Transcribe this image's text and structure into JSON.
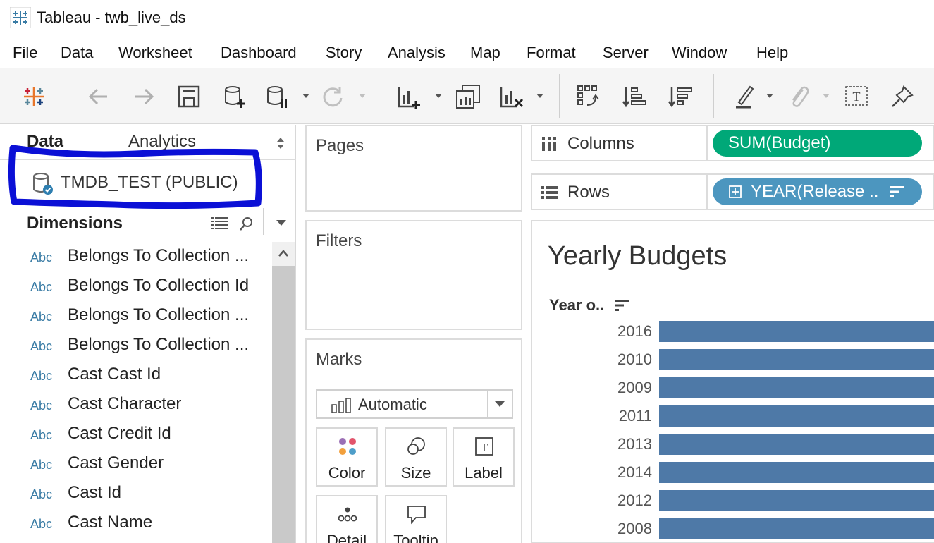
{
  "window": {
    "title": "Tableau - twb_live_ds",
    "app_icon": "tableau-logo-icon"
  },
  "menu": [
    "File",
    "Data",
    "Worksheet",
    "Dashboard",
    "Story",
    "Analysis",
    "Map",
    "Format",
    "Server",
    "Window",
    "Help"
  ],
  "toolbar": {
    "icons": [
      "tableau-logo-icon",
      "back-icon",
      "forward-icon",
      "save-icon",
      "new-data-source-icon",
      "pause-updates-icon",
      "refresh-icon",
      "new-worksheet-icon",
      "duplicate-sheet-icon",
      "clear-sheet-icon",
      "swap-rows-columns-icon",
      "sort-ascending-icon",
      "sort-descending-icon",
      "highlight-icon",
      "group-icon",
      "show-labels-icon",
      "pin-icon"
    ]
  },
  "data_pane": {
    "tab_data": "Data",
    "tab_analytics": "Analytics",
    "datasource": "TMDB_TEST (PUBLIC)",
    "dimensions_title": "Dimensions",
    "fields": [
      {
        "type": "Abc",
        "name": "Belongs To Collection ..."
      },
      {
        "type": "Abc",
        "name": "Belongs To Collection Id"
      },
      {
        "type": "Abc",
        "name": "Belongs To Collection ..."
      },
      {
        "type": "Abc",
        "name": "Belongs To Collection ..."
      },
      {
        "type": "Abc",
        "name": "Cast Cast Id"
      },
      {
        "type": "Abc",
        "name": "Cast Character"
      },
      {
        "type": "Abc",
        "name": "Cast Credit Id"
      },
      {
        "type": "Abc",
        "name": "Cast Gender"
      },
      {
        "type": "Abc",
        "name": "Cast Id"
      },
      {
        "type": "Abc",
        "name": "Cast Name"
      }
    ]
  },
  "cards": {
    "pages": "Pages",
    "filters": "Filters",
    "marks": "Marks",
    "mark_type": "Automatic",
    "mark_buttons": [
      "Color",
      "Size",
      "Label",
      "Detail",
      "Tooltip"
    ]
  },
  "shelves": {
    "columns_label": "Columns",
    "columns_pill": "SUM(Budget)",
    "rows_label": "Rows",
    "rows_pill": "YEAR(Release .."
  },
  "view": {
    "title": "Yearly Budgets",
    "axis_header": "Year o..",
    "colors": {
      "bar": "#4e79a7",
      "measure_pill": "#00a878",
      "dimension_pill": "#4c96bf",
      "highlight": "#0b10d6"
    }
  },
  "chart_data": {
    "type": "bar",
    "orientation": "horizontal",
    "title": "Yearly Budgets",
    "ylabel": "Year o..",
    "categories": [
      "2016",
      "2010",
      "2009",
      "2011",
      "2013",
      "2014",
      "2012",
      "2008"
    ],
    "note_values_truncated": true
  }
}
